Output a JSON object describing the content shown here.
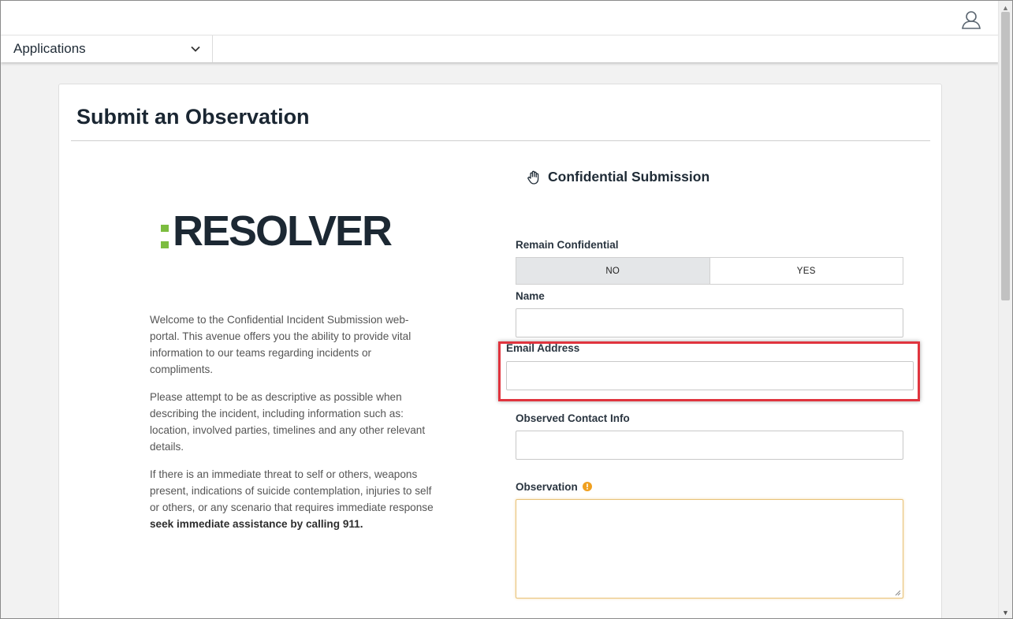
{
  "header": {
    "user_icon": "user-icon"
  },
  "appbar": {
    "applications_label": "Applications"
  },
  "card": {
    "title": "Submit an Observation",
    "logo_text": "RESOLVER",
    "intro": {
      "p1": "Welcome to the Confidential Incident Submission web-portal. This avenue offers you the ability to provide vital information to our teams regarding incidents or compliments.",
      "p2": "Please attempt to be as descriptive as possible when describing the incident, including information such as: location, involved parties, timelines and any other relevant details.",
      "p3_prefix": "If there is an immediate threat to self or others, weapons present, indications of suicide contemplation, injuries to self or others, or any scenario that requires immediate response ",
      "p3_bold": "seek immediate assistance by calling 911."
    }
  },
  "form": {
    "section_title": "Confidential Submission",
    "section_icon": "hand-icon",
    "remain_confidential_label": "Remain Confidential",
    "options": [
      "NO",
      "YES"
    ],
    "selected_option": "NO",
    "name_label": "Name",
    "name_value": "",
    "email_label": "Email Address",
    "email_value": "",
    "contact_label": "Observed Contact Info",
    "contact_value": "",
    "observation_label": "Observation",
    "observation_value": ""
  },
  "colors": {
    "highlight": "#e0343e",
    "logo_accent": "#7cbd3f",
    "required_icon": "#f0a020"
  }
}
